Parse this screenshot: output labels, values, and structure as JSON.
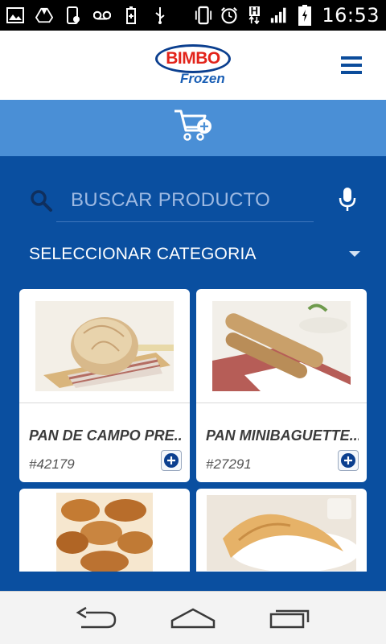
{
  "status_bar": {
    "time": "16:53",
    "network_label": "H",
    "icons": [
      "image-icon",
      "drive-icon",
      "phone-settings-icon",
      "voicemail-icon",
      "battery-saver-icon",
      "usb-icon",
      "vibrate-icon",
      "alarm-icon",
      "data-arrows-icon",
      "signal-icon",
      "battery-charging-icon"
    ]
  },
  "header": {
    "logo_brand": "BIMBO",
    "logo_sub": "Frozen",
    "menu_icon": "hamburger-menu-icon"
  },
  "cart": {
    "icon": "cart-add-icon"
  },
  "search": {
    "placeholder": "BUSCAR PRODUCTO",
    "value": ""
  },
  "category": {
    "label": "SELECCIONAR CATEGORIA"
  },
  "products": [
    {
      "name": "PAN DE CAMPO PRE...",
      "code": "#42179"
    },
    {
      "name": "PAN MINIBAGUETTE...",
      "code": "#27291"
    },
    {
      "name": "",
      "code": ""
    },
    {
      "name": "",
      "code": ""
    }
  ],
  "colors": {
    "primary": "#0a4fa0",
    "cart_bar": "#4a8fd6",
    "logo_red": "#e2231a",
    "logo_blue": "#0b3f8f"
  }
}
